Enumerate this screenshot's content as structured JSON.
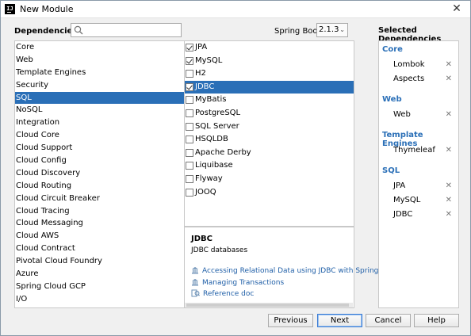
{
  "window": {
    "title": "New Module",
    "close_glyph": "✕"
  },
  "header": {
    "dependencies_label": "Dependencies",
    "search": {
      "value": "",
      "placeholder": ""
    },
    "spring_boot_label": "Spring Boot",
    "spring_boot_version": "2.1.3",
    "selected_dependencies_label": "Selected Dependencies"
  },
  "categories": [
    {
      "label": "Core",
      "selected": false
    },
    {
      "label": "Web",
      "selected": false
    },
    {
      "label": "Template Engines",
      "selected": false
    },
    {
      "label": "Security",
      "selected": false
    },
    {
      "label": "SQL",
      "selected": true
    },
    {
      "label": "NoSQL",
      "selected": false
    },
    {
      "label": "Integration",
      "selected": false
    },
    {
      "label": "Cloud Core",
      "selected": false
    },
    {
      "label": "Cloud Support",
      "selected": false
    },
    {
      "label": "Cloud Config",
      "selected": false
    },
    {
      "label": "Cloud Discovery",
      "selected": false
    },
    {
      "label": "Cloud Routing",
      "selected": false
    },
    {
      "label": "Cloud Circuit Breaker",
      "selected": false
    },
    {
      "label": "Cloud Tracing",
      "selected": false
    },
    {
      "label": "Cloud Messaging",
      "selected": false
    },
    {
      "label": "Cloud AWS",
      "selected": false
    },
    {
      "label": "Cloud Contract",
      "selected": false
    },
    {
      "label": "Pivotal Cloud Foundry",
      "selected": false
    },
    {
      "label": "Azure",
      "selected": false
    },
    {
      "label": "Spring Cloud GCP",
      "selected": false
    },
    {
      "label": "I/O",
      "selected": false
    }
  ],
  "dependencies": [
    {
      "label": "JPA",
      "checked": true,
      "selected": false
    },
    {
      "label": "MySQL",
      "checked": true,
      "selected": false
    },
    {
      "label": "H2",
      "checked": false,
      "selected": false
    },
    {
      "label": "JDBC",
      "checked": true,
      "selected": true
    },
    {
      "label": "MyBatis",
      "checked": false,
      "selected": false
    },
    {
      "label": "PostgreSQL",
      "checked": false,
      "selected": false
    },
    {
      "label": "SQL Server",
      "checked": false,
      "selected": false
    },
    {
      "label": "HSQLDB",
      "checked": false,
      "selected": false
    },
    {
      "label": "Apache Derby",
      "checked": false,
      "selected": false
    },
    {
      "label": "Liquibase",
      "checked": false,
      "selected": false
    },
    {
      "label": "Flyway",
      "checked": false,
      "selected": false
    },
    {
      "label": "JOOQ",
      "checked": false,
      "selected": false
    }
  ],
  "description": {
    "title": "JDBC",
    "text": "JDBC databases",
    "links": [
      {
        "label": "Accessing Relational Data using JDBC with Spring",
        "icon": "guide-icon"
      },
      {
        "label": "Managing Transactions",
        "icon": "guide-icon"
      },
      {
        "label": "Reference doc",
        "icon": "reference-doc-icon"
      }
    ]
  },
  "selected_dependencies": [
    {
      "group": "Core",
      "items": [
        "Lombok",
        "Aspects"
      ]
    },
    {
      "group": "Web",
      "items": [
        "Web"
      ]
    },
    {
      "group": "Template Engines",
      "items": [
        "Thymeleaf"
      ]
    },
    {
      "group": "SQL",
      "items": [
        "JPA",
        "MySQL",
        "JDBC"
      ]
    }
  ],
  "remove_glyph": "✕",
  "buttons": {
    "previous": "Previous",
    "next": "Next",
    "cancel": "Cancel",
    "help": "Help"
  },
  "colors": {
    "selection": "#2a6fb7",
    "link": "#2160a8",
    "group_title": "#2a6fb7"
  }
}
